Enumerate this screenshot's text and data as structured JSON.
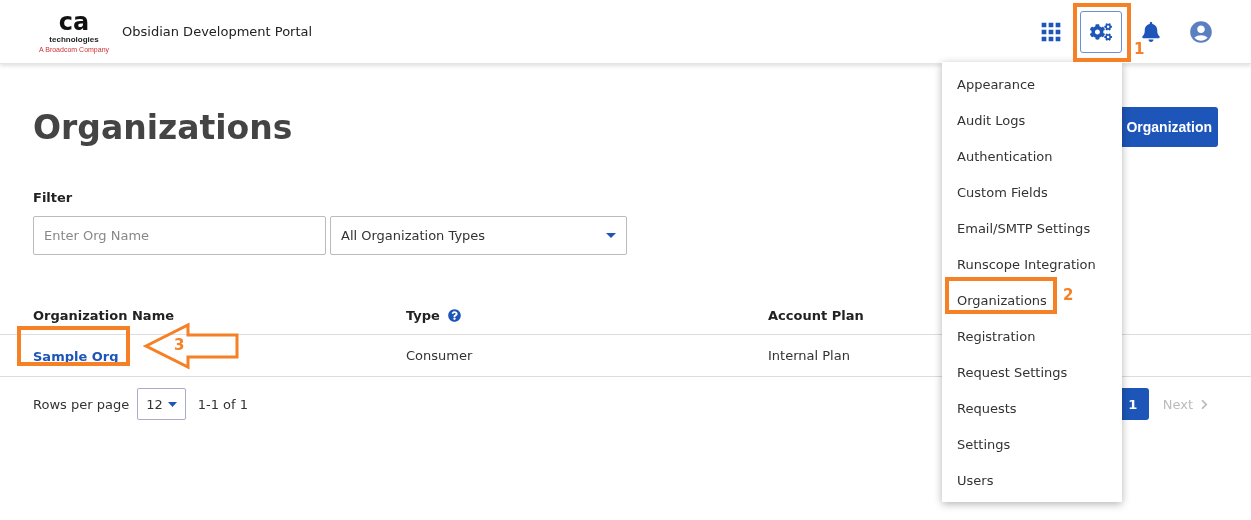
{
  "header": {
    "logo": {
      "mark": "ca",
      "line1": "technologies",
      "line2": "A Broadcom Company"
    },
    "title": "Obsidian Development Portal"
  },
  "page": {
    "title": "Organizations",
    "add_button": "Organization"
  },
  "filter": {
    "label": "Filter",
    "name_placeholder": "Enter Org Name",
    "type_value": "All Organization Types"
  },
  "table": {
    "columns": [
      {
        "label": "Organization Name",
        "help": false
      },
      {
        "label": "Type",
        "help": true
      },
      {
        "label": "Account Plan",
        "help": false
      }
    ],
    "rows": [
      [
        "Sample Org",
        "Consumer",
        "Internal Plan"
      ]
    ]
  },
  "footer": {
    "rows_label": "Rows per page",
    "rows_value": "12",
    "range": "1-1 of 1",
    "pages": [
      {
        "label": "1",
        "selected": true
      }
    ],
    "next": "Next"
  },
  "settings_menu": {
    "items": [
      "Appearance",
      "Audit Logs",
      "Authentication",
      "Custom Fields",
      "Email/SMTP Settings",
      "Runscope Integration",
      "Organizations",
      "Registration",
      "Request Settings",
      "Requests",
      "Settings",
      "Users"
    ]
  },
  "annotations": [
    {
      "label": "1"
    },
    {
      "label": "2"
    },
    {
      "label": "3"
    }
  ]
}
